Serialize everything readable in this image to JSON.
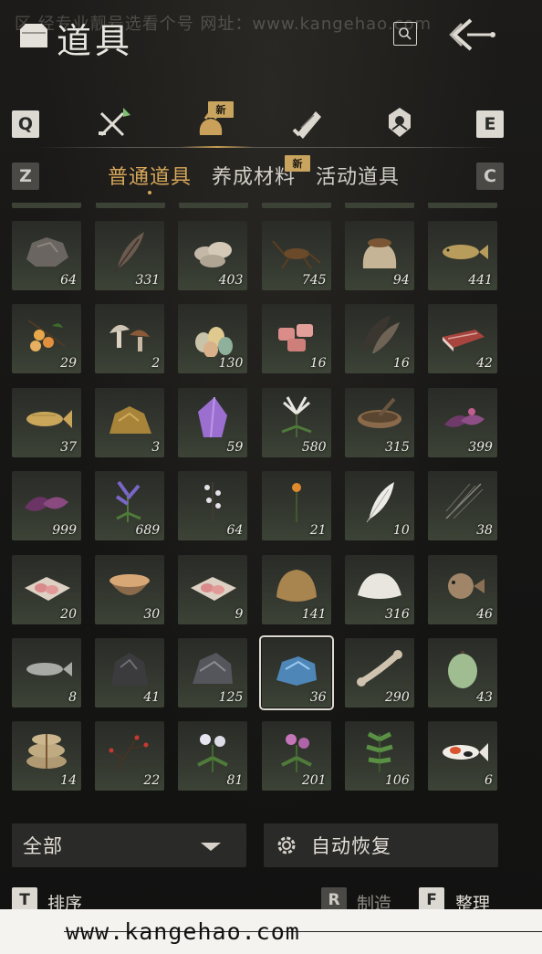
{
  "watermark_top": "区 经专业靓号选看个号  网址：www.kangehao.com",
  "header": {
    "title": "道具"
  },
  "categories": {
    "left_key": "Q",
    "right_key": "E",
    "new_badge": "新"
  },
  "subtabs": {
    "left_key": "Z",
    "right_key": "C",
    "items": [
      {
        "label": "普通道具",
        "active": true
      },
      {
        "label": "养成材料",
        "active": false
      },
      {
        "label": "活动道具",
        "active": false
      }
    ],
    "new_badge": "新"
  },
  "items": [
    {
      "icon": "ore-rock-icon",
      "qty": "64"
    },
    {
      "icon": "feather-icon",
      "qty": "331"
    },
    {
      "icon": "shells-icon",
      "qty": "403"
    },
    {
      "icon": "cricket-icon",
      "qty": "745"
    },
    {
      "icon": "grain-sack-icon",
      "qty": "94"
    },
    {
      "icon": "fish-icon",
      "qty": "441"
    },
    {
      "icon": "fruit-branch-icon",
      "qty": "29"
    },
    {
      "icon": "mushrooms-icon",
      "qty": "2"
    },
    {
      "icon": "eggs-icon",
      "qty": "130"
    },
    {
      "icon": "raw-meat-chunks-icon",
      "qty": "16"
    },
    {
      "icon": "dark-feathers-icon",
      "qty": "16"
    },
    {
      "icon": "meat-slab-icon",
      "qty": "42"
    },
    {
      "icon": "carp-icon",
      "qty": "37"
    },
    {
      "icon": "gold-ore-icon",
      "qty": "3"
    },
    {
      "icon": "amethyst-crystal-icon",
      "qty": "59"
    },
    {
      "icon": "white-herb-flower-icon",
      "qty": "580"
    },
    {
      "icon": "herb-bowl-icon",
      "qty": "315"
    },
    {
      "icon": "purple-leaf-flower-icon",
      "qty": "399"
    },
    {
      "icon": "purple-leaves-icon",
      "qty": "999"
    },
    {
      "icon": "lavender-icon",
      "qty": "689"
    },
    {
      "icon": "white-blossom-branch-icon",
      "qty": "64"
    },
    {
      "icon": "orange-flower-icon",
      "qty": "21"
    },
    {
      "icon": "white-feather-icon",
      "qty": "10"
    },
    {
      "icon": "grey-feather-icon",
      "qty": "38"
    },
    {
      "icon": "meat-on-paper-icon",
      "qty": "20"
    },
    {
      "icon": "soup-bowl-icon",
      "qty": "30"
    },
    {
      "icon": "meat-on-paper-icon",
      "qty": "9"
    },
    {
      "icon": "brown-fur-icon",
      "qty": "141"
    },
    {
      "icon": "white-fur-icon",
      "qty": "316"
    },
    {
      "icon": "pufferfish-icon",
      "qty": "46"
    },
    {
      "icon": "silver-fish-icon",
      "qty": "8"
    },
    {
      "icon": "coal-ore-icon",
      "qty": "41"
    },
    {
      "icon": "iron-ore-icon",
      "qty": "125"
    },
    {
      "icon": "blue-ore-icon",
      "qty": "36",
      "selected": true
    },
    {
      "icon": "bone-icon",
      "qty": "290"
    },
    {
      "icon": "melon-icon",
      "qty": "43"
    },
    {
      "icon": "rice-sacks-icon",
      "qty": "14"
    },
    {
      "icon": "red-berry-branch-icon",
      "qty": "22"
    },
    {
      "icon": "white-chrysanthemum-icon",
      "qty": "81"
    },
    {
      "icon": "pink-chrysanthemum-icon",
      "qty": "201"
    },
    {
      "icon": "green-herb-icon",
      "qty": "106"
    },
    {
      "icon": "koi-fish-icon",
      "qty": "6"
    }
  ],
  "filter": {
    "label": "全部"
  },
  "auto_restore": {
    "label": "自动恢复"
  },
  "footer": {
    "sort_key": "T",
    "sort_label": "排序",
    "craft_key": "R",
    "craft_label": "制造",
    "organize_key": "F",
    "organize_label": "整理"
  },
  "bottom_banner": {
    "text": "www.kangehao.com"
  },
  "colors": {
    "accent": "#d8a75a",
    "cell_bg": "#33372f",
    "page_bg": "#171716"
  }
}
